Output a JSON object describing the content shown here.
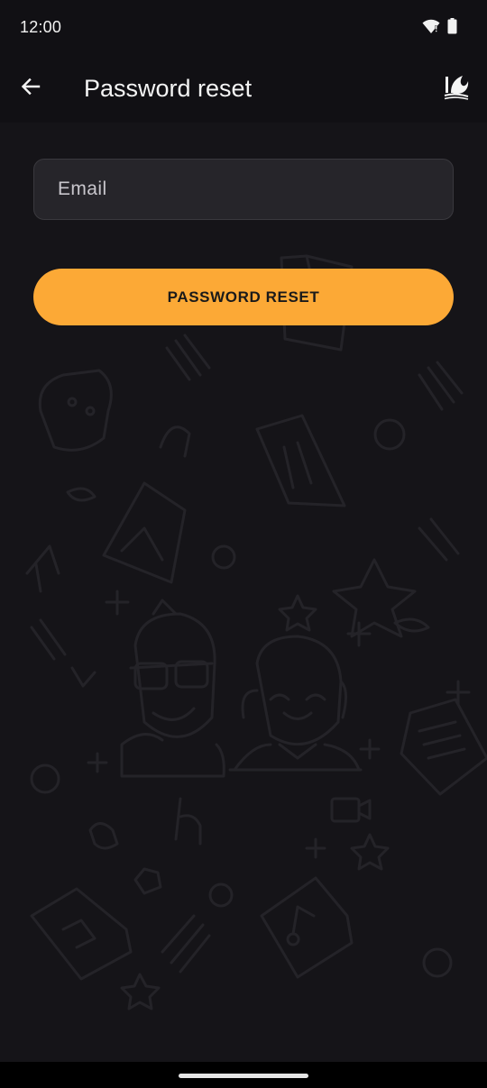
{
  "status_bar": {
    "time": "12:00",
    "icons": [
      "wifi-icon",
      "battery-icon"
    ]
  },
  "app_bar": {
    "title": "Password reset",
    "back_icon": "arrow-left-icon",
    "logo_icon": "app-logo-icon"
  },
  "form": {
    "email_placeholder": "Email",
    "email_value": "",
    "submit_label": "PASSWORD RESET"
  },
  "colors": {
    "background": "#151418",
    "app_bar": "#111014",
    "accent": "#fca936",
    "field_bg": "#28272c"
  }
}
